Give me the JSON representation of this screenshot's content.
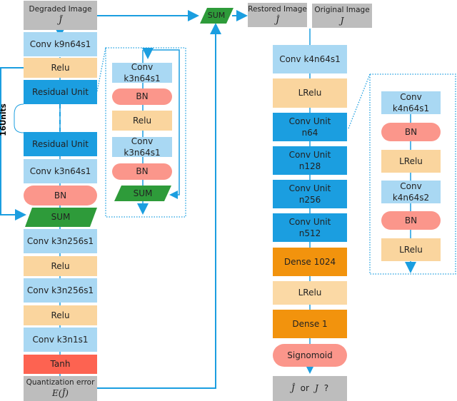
{
  "generator": {
    "input": {
      "label": "Degraded Image",
      "symbol": "J̃"
    },
    "blocks": [
      {
        "label": "Conv k9n64s1",
        "type": "conv"
      },
      {
        "label": "Relu",
        "type": "relu"
      },
      {
        "label": "Residual Unit",
        "type": "residual"
      },
      {
        "label": "Residual Unit",
        "type": "residual"
      },
      {
        "label": "Conv k3n64s1",
        "type": "conv"
      },
      {
        "label": "BN",
        "type": "bn"
      },
      {
        "label": "SUM",
        "type": "sum"
      },
      {
        "label": "Conv k3n256s1",
        "type": "conv"
      },
      {
        "label": "Relu",
        "type": "relu"
      },
      {
        "label": "Conv k3n256s1",
        "type": "conv"
      },
      {
        "label": "Relu",
        "type": "relu"
      },
      {
        "label": "Conv k3n1s1",
        "type": "conv"
      },
      {
        "label": "Tanh",
        "type": "tanh"
      }
    ],
    "repeat_label": "16Units",
    "output": {
      "label": "Quantization error",
      "symbol": "E(J̃)"
    }
  },
  "residual_unit": {
    "blocks": [
      {
        "label": "Conv k3n64s1"
      },
      {
        "label": "BN"
      },
      {
        "label": "Relu"
      },
      {
        "label": "Conv k3n64s1"
      },
      {
        "label": "BN"
      },
      {
        "label": "SUM"
      }
    ]
  },
  "top_sum": {
    "label": "SUM"
  },
  "restored": {
    "label": "Restored Image",
    "symbol": "Ĵ"
  },
  "original": {
    "label": "Original Image",
    "symbol": "J"
  },
  "discriminator": {
    "blocks": [
      {
        "label": "Conv k4n64s1"
      },
      {
        "label": "LRelu"
      },
      {
        "label": "Conv Unit",
        "sub": "n64"
      },
      {
        "label": "Conv Unit",
        "sub": "n128"
      },
      {
        "label": "Conv Unit",
        "sub": "n256"
      },
      {
        "label": "Conv Unit",
        "sub": "n512"
      },
      {
        "label": "Dense 1024"
      },
      {
        "label": "LRelu"
      },
      {
        "label": "Dense 1"
      },
      {
        "label": "Signomoid"
      }
    ],
    "output": {
      "hat": "Ĵ",
      "or": "or",
      "plain": "J",
      "q": "?"
    }
  },
  "conv_unit": {
    "blocks": [
      {
        "label": "Conv k4n64s1"
      },
      {
        "label": "BN"
      },
      {
        "label": "LRelu"
      },
      {
        "label": "Conv k4n64s2"
      },
      {
        "label": "BN"
      },
      {
        "label": "LRelu"
      }
    ]
  },
  "colors": {
    "line": "#1b9ee0",
    "conv": "#a9d8f3",
    "relu": "#fad59e",
    "residual": "#1b9ee0",
    "bn": "#fb968b",
    "tanh": "#fd6351",
    "dense": "#f2930d",
    "sum": "#2e9b3a",
    "io": "#bdbdbd"
  }
}
